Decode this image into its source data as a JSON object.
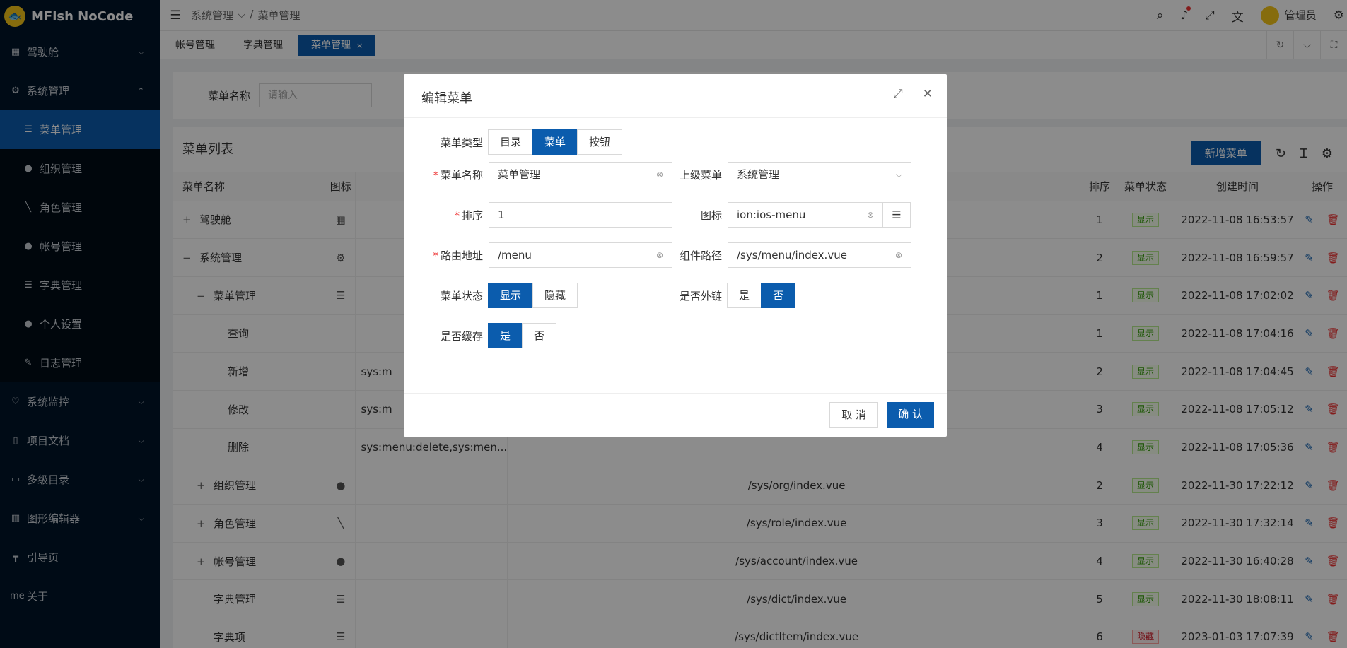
{
  "app": {
    "title": "MFish NoCode"
  },
  "sidebar": {
    "items": [
      {
        "label": "驾驶舱",
        "icon": "dashboard-icon",
        "chevron": "⌵"
      },
      {
        "label": "系统管理",
        "icon": "gear-icon",
        "chevron": "⌃"
      },
      {
        "label": "菜单管理",
        "icon": "menu-icon"
      },
      {
        "label": "组织管理",
        "icon": "org-icon"
      },
      {
        "label": "角色管理",
        "icon": "role-icon"
      },
      {
        "label": "帐号管理",
        "icon": "users-icon"
      },
      {
        "label": "字典管理",
        "icon": "list-icon"
      },
      {
        "label": "个人设置",
        "icon": "user-icon"
      },
      {
        "label": "日志管理",
        "icon": "log-icon"
      },
      {
        "label": "系统监控",
        "icon": "monitor-icon",
        "chevron": "⌵"
      },
      {
        "label": "项目文档",
        "icon": "book-icon",
        "chevron": "⌵"
      },
      {
        "label": "多级目录",
        "icon": "folder-icon",
        "chevron": "⌵"
      },
      {
        "label": "图形编辑器",
        "icon": "chart-icon",
        "chevron": "⌵"
      },
      {
        "label": "引导页",
        "icon": "guide-icon"
      },
      {
        "label": "关于",
        "icon": "about-icon"
      }
    ]
  },
  "header": {
    "crumb1": "系统管理",
    "crumb_sep": "/",
    "crumb2": "菜单管理",
    "user": "管理员"
  },
  "tabs": [
    "帐号管理",
    "字典管理",
    "菜单管理"
  ],
  "search": {
    "label": "菜单名称",
    "placeholder": "请输入"
  },
  "table": {
    "title": "菜单列表",
    "add_button": "新增菜单",
    "headers": {
      "name": "菜单名称",
      "icon": "图标",
      "sort": "排序",
      "status": "菜单状态",
      "time": "创建时间",
      "ops": "操作"
    },
    "rows": [
      {
        "toggle": "+",
        "name": "驾驶舱",
        "perm": "",
        "path": "",
        "sort": "1",
        "status": "显示",
        "time": "2022-11-08 16:53:57"
      },
      {
        "toggle": "−",
        "name": "系统管理",
        "perm": "",
        "path": "",
        "sort": "2",
        "status": "显示",
        "time": "2022-11-08 16:59:57"
      },
      {
        "toggle": "−",
        "name": "菜单管理",
        "perm": "",
        "path": "",
        "sort": "1",
        "status": "显示",
        "time": "2022-11-08 17:02:02"
      },
      {
        "toggle": "",
        "name": "查询",
        "perm": "",
        "path": "",
        "sort": "1",
        "status": "显示",
        "time": "2022-11-08 17:04:16"
      },
      {
        "toggle": "",
        "name": "新增",
        "perm": "sys:m",
        "path": "",
        "sort": "2",
        "status": "显示",
        "time": "2022-11-08 17:04:45"
      },
      {
        "toggle": "",
        "name": "修改",
        "perm": "sys:m",
        "path": "",
        "sort": "3",
        "status": "显示",
        "time": "2022-11-08 17:05:12"
      },
      {
        "toggle": "",
        "name": "删除",
        "perm": "sys:menu:delete,sys:men...",
        "path": "",
        "sort": "4",
        "status": "显示",
        "time": "2022-11-08 17:05:36"
      },
      {
        "toggle": "+",
        "name": "组织管理",
        "perm": "",
        "path": "/sys/org/index.vue",
        "sort": "2",
        "status": "显示",
        "time": "2022-11-30 17:22:12"
      },
      {
        "toggle": "+",
        "name": "角色管理",
        "perm": "",
        "path": "/sys/role/index.vue",
        "sort": "3",
        "status": "显示",
        "time": "2022-11-30 17:32:14"
      },
      {
        "toggle": "+",
        "name": "帐号管理",
        "perm": "",
        "path": "/sys/account/index.vue",
        "sort": "4",
        "status": "显示",
        "time": "2022-11-30 16:40:28"
      },
      {
        "toggle": "",
        "name": "字典管理",
        "perm": "",
        "path": "/sys/dict/index.vue",
        "sort": "5",
        "status": "显示",
        "time": "2022-11-30 18:08:11"
      },
      {
        "toggle": "",
        "name": "字典项",
        "perm": "",
        "path": "/sys/dictItem/index.vue",
        "sort": "6",
        "status": "隐藏",
        "time": "2023-01-03 17:07:39"
      }
    ]
  },
  "modal": {
    "title": "编辑菜单",
    "type_label": "菜单类型",
    "types": [
      "目录",
      "菜单",
      "按钮"
    ],
    "type_selected": "菜单",
    "name_label": "菜单名称",
    "name_value": "菜单管理",
    "parent_label": "上级菜单",
    "parent_value": "系统管理",
    "sort_label": "排序",
    "sort_value": "1",
    "icon_label": "图标",
    "icon_value": "ion:ios-menu",
    "route_label": "路由地址",
    "route_value": "/menu",
    "component_label": "组件路径",
    "component_value": "/sys/menu/index.vue",
    "status_label": "菜单状态",
    "status_opts": [
      "显示",
      "隐藏"
    ],
    "external_label": "是否外链",
    "external_opts": [
      "是",
      "否"
    ],
    "cache_label": "是否缓存",
    "cache_opts": [
      "是",
      "否"
    ],
    "cancel": "取 消",
    "ok": "确 认"
  },
  "colors": {
    "primary": "#0b5cad",
    "sidebar": "#001529",
    "danger": "#e33"
  }
}
